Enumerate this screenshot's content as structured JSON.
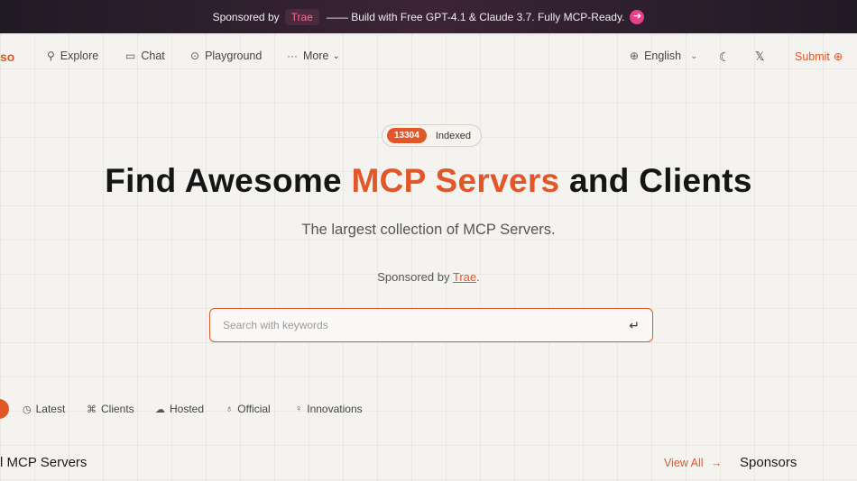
{
  "banner": {
    "prefix": "Sponsored by",
    "sponsor": "Trae",
    "message": "—— Build with Free GPT-4.1 & Claude 3.7. Fully MCP-Ready.",
    "arrow": "➔"
  },
  "nav": {
    "brand": "so",
    "items": [
      {
        "label": "Explore",
        "icon": "search-icon",
        "glyph": "⚲"
      },
      {
        "label": "Chat",
        "icon": "chat-icon",
        "glyph": "▭"
      },
      {
        "label": "Playground",
        "icon": "play-icon",
        "glyph": "⊙"
      },
      {
        "label": "More",
        "icon": "more-icon",
        "glyph": "···",
        "caret": "⌄"
      }
    ],
    "language": {
      "label": "English",
      "glyph": "⊕",
      "caret": "⌄"
    },
    "theme_glyph": "☾",
    "x_glyph": "𝕏",
    "submit": {
      "label": "Submit",
      "glyph": "⊕"
    }
  },
  "hero": {
    "count": "13304",
    "count_label": "Indexed",
    "headline_pre": "Find Awesome ",
    "headline_accent": "MCP Servers",
    "headline_post": " and Clients",
    "subline": "The largest collection of MCP Servers.",
    "sponsor_prefix": "Sponsored by ",
    "sponsor_link": "Trae",
    "sponsor_suffix": "."
  },
  "search": {
    "placeholder": "Search with keywords",
    "enter_glyph": "↵"
  },
  "tabs": [
    {
      "label": "Latest",
      "icon": "clock-icon",
      "glyph": "◷"
    },
    {
      "label": "Clients",
      "icon": "grid-icon",
      "glyph": "⌘"
    },
    {
      "label": "Hosted",
      "icon": "cloud-icon",
      "glyph": "☁"
    },
    {
      "label": "Official",
      "icon": "medal-icon",
      "glyph": "♁"
    },
    {
      "label": "Innovations",
      "icon": "lightbulb-icon",
      "glyph": "♀"
    }
  ],
  "section": {
    "title": "l MCP Servers",
    "view_all": "View All",
    "view_all_arrow": "→",
    "sponsors": "Sponsors"
  },
  "colors": {
    "accent": "#e0572a",
    "banner_bg": "#2a1f2f",
    "background": "#f5f3ef"
  }
}
